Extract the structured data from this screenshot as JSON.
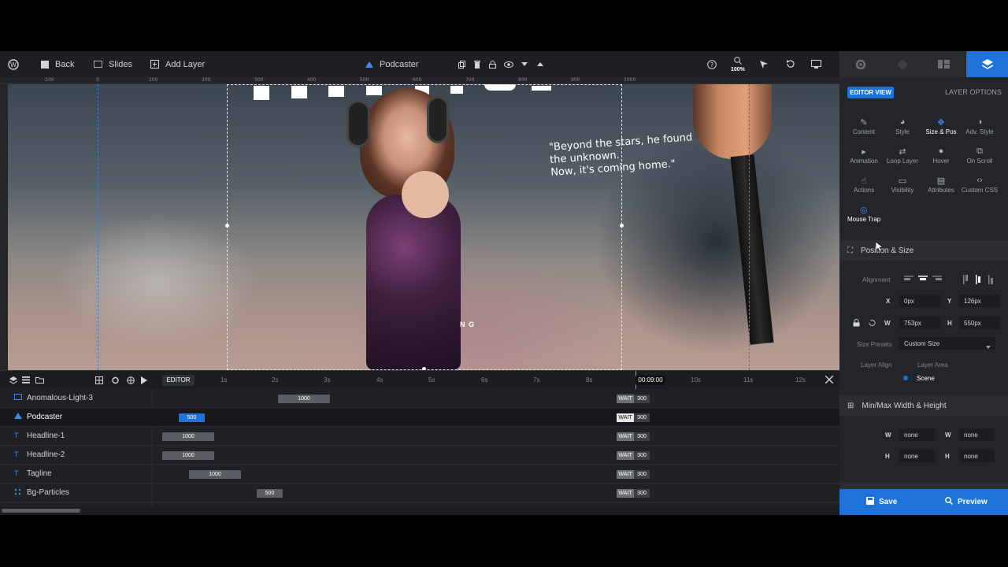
{
  "topbar": {
    "back_label": "Back",
    "slides_label": "Slides",
    "add_layer_label": "Add Layer",
    "layer_title": "Podcaster",
    "zoom": "100%"
  },
  "ruler": [
    "-100",
    "0",
    "100",
    "200",
    "300",
    "400",
    "500",
    "600",
    "700",
    "800",
    "900",
    "1000"
  ],
  "canvas": {
    "quote": [
      "\"Beyond the stars, he found",
      "the unknown.",
      "Now, it's coming home.\""
    ],
    "small_text": "N G"
  },
  "timeline": {
    "editor_label": "EDITOR",
    "time_marks": [
      "1s",
      "2s",
      "3s",
      "4s",
      "5s",
      "6s",
      "7s",
      "8s",
      "10s",
      "11s",
      "12s"
    ],
    "current_time": "00:09:00",
    "wait_label": "WAIT",
    "wait_value": "300",
    "layers": [
      {
        "name": "Anomalous-Light-3",
        "icon": "image-icon",
        "duration": "1000"
      },
      {
        "name": "Podcaster",
        "icon": "podcaster-icon",
        "duration": "500"
      },
      {
        "name": "Headline-1",
        "icon": "text-icon",
        "duration": "1000"
      },
      {
        "name": "Headline-2",
        "icon": "text-icon",
        "duration": "1000"
      },
      {
        "name": "Tagline",
        "icon": "text-icon",
        "duration": "1000"
      },
      {
        "name": "Bg-Particles",
        "icon": "particles-icon",
        "duration": "500"
      }
    ]
  },
  "panel": {
    "editor_view": "EDITOR VIEW",
    "layer_options": "LAYER OPTIONS",
    "subtabs": [
      "Content",
      "Style",
      "Size & Pos",
      "Adv. Style",
      "Animation",
      "Loop Layer",
      "Hover",
      "On Scroll",
      "Actions",
      "Visibility",
      "Attributes",
      "Custom CSS",
      "Mouse Trap"
    ],
    "position_size": {
      "title": "Position & Size",
      "alignment_label": "Alignment",
      "x_label": "X",
      "x_value": "0px",
      "y_label": "Y",
      "y_value": "126px",
      "w_label": "W",
      "w_value": "753px",
      "h_label": "H",
      "h_value": "550px",
      "size_presets_label": "Size Presets",
      "size_presets_value": "Custom Size",
      "layer_align_label": "Layer Align",
      "layer_area": "Layer Area",
      "scene": "Scene"
    },
    "minmax": {
      "title": "Min/Max Width & Height",
      "min_w": "none",
      "max_w": "none",
      "min_h": "none",
      "max_h": "none"
    },
    "save_label": "Save",
    "preview_label": "Preview"
  }
}
